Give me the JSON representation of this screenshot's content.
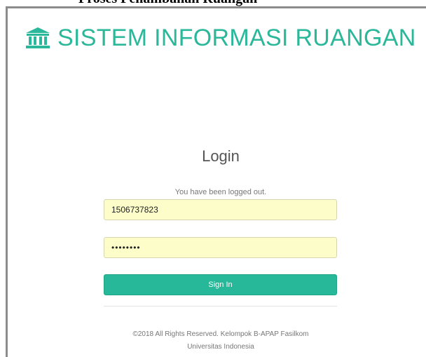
{
  "caption": {
    "text": "Proses Penambahan Ruangan"
  },
  "header": {
    "icon": "university-icon",
    "title": "SISTEM INFORMASI RUANGAN",
    "accent_color": "#2ab79a"
  },
  "login": {
    "title": "Login",
    "message": "You have been logged out.",
    "username_value": "1506737823",
    "password_value": "••••••••",
    "signin_label": "Sign In",
    "button_color": "#26b899",
    "field_background": "#fcfdc9"
  },
  "footer": {
    "line1": "©2018 All Rights Reserved. Kelompok B-APAP Fasilkom",
    "line2": "Universitas Indonesia"
  }
}
